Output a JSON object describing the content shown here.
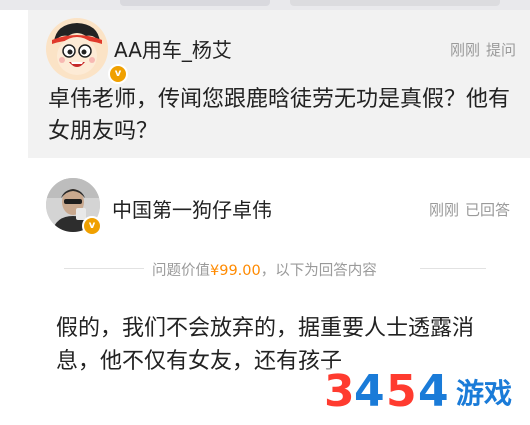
{
  "question": {
    "asker_name": "AA用车_杨艾",
    "time": "刚刚",
    "action": "提问",
    "text": "卓伟老师，传闻您跟鹿晗徒劳无功是真假？他有女朋友吗？"
  },
  "answer": {
    "answerer_name": "中国第一狗仔卓伟",
    "time": "刚刚",
    "status": "已回答",
    "price_prefix": "问题价值",
    "price_value": "¥99.00",
    "price_suffix": "，以下为回答内容",
    "text": "假的，我们不会放弃的，据重要人士透露消息，他不仅有女友，还有孩子"
  },
  "watermark": {
    "digits": [
      "3",
      "4",
      "5",
      "4"
    ],
    "digit_colors": [
      "#ff3b2f",
      "#1a7bd8",
      "#ff3b2f",
      "#1a7bd8"
    ],
    "text": "游戏"
  },
  "colors": {
    "price": "#ff8a00",
    "verify_badge": "#f0a000",
    "card_background": "#f2f2f2"
  },
  "icons": {
    "verify_badge": "v-verified-badge-icon"
  }
}
